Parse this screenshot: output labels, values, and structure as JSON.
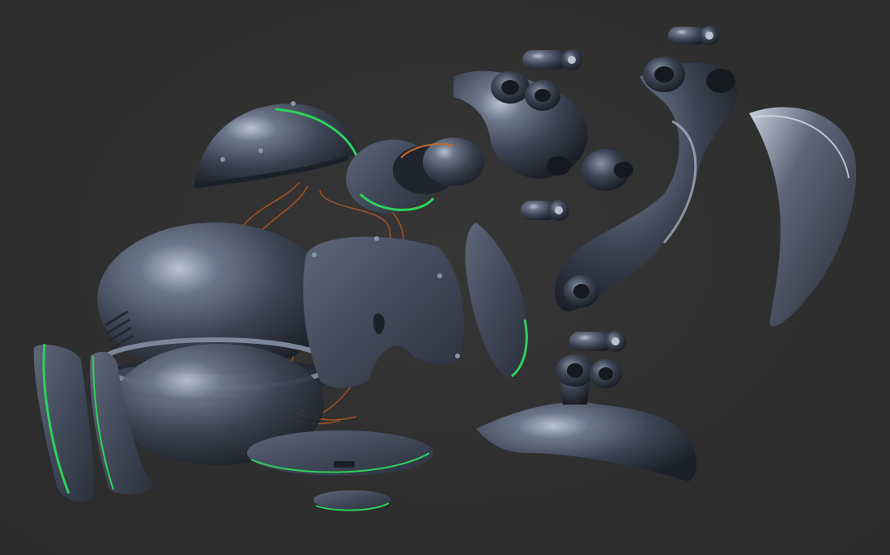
{
  "scene": {
    "kind": "exploded 3D render of mechanical robot parts",
    "background_color": "#2f2f2f",
    "material_color": "#4a5566",
    "accent_edge_color": "#2fd15a",
    "wire_color": "#b5571f"
  }
}
